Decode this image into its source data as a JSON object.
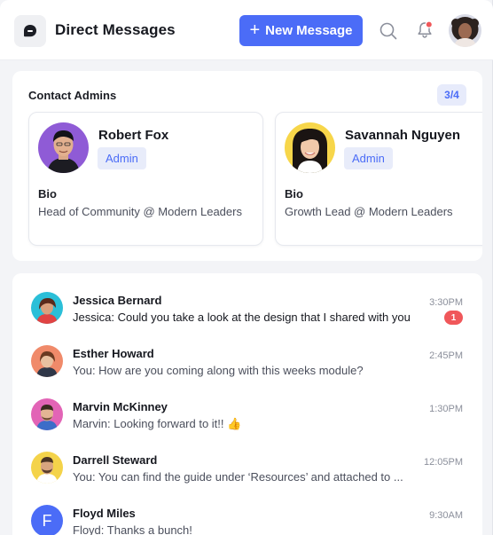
{
  "header": {
    "title": "Direct Messages",
    "new_message_label": "New Message",
    "app_icon": "chat-bubble-icon",
    "search_icon": "search-icon",
    "bell_icon": "bell-icon",
    "has_notification": true
  },
  "admins": {
    "title": "Contact Admins",
    "counter": "3/4",
    "cards": [
      {
        "name": "Robert Fox",
        "role": "Admin",
        "bio_label": "Bio",
        "bio": "Head of Community @ Modern Leaders"
      },
      {
        "name": "Savannah Nguyen",
        "role": "Admin",
        "bio_label": "Bio",
        "bio": "Growth Lead @ Modern Leaders"
      }
    ]
  },
  "messages": [
    {
      "name": "Jessica Bernard",
      "preview": "Jessica: Could you take a look at the design that I shared with you?",
      "time": "3:30PM",
      "unread": "1"
    },
    {
      "name": "Esther Howard",
      "preview": "You: How are you coming along with this weeks module?",
      "time": "2:45PM"
    },
    {
      "name": "Marvin McKinney",
      "preview": "Marvin: Looking forward to it!! 👍",
      "time": "1:30PM"
    },
    {
      "name": "Darrell Steward",
      "preview": "You: You can find the guide under ‘Resources’ and attached to ...",
      "time": "12:05PM"
    },
    {
      "name": "Floyd Miles",
      "preview": "Floyd: Thanks a bunch!",
      "time": "9:30AM",
      "initial": "F"
    }
  ],
  "colors": {
    "accent": "#4b6cf7",
    "badge_bg": "#e8ecfa",
    "unread": "#f0575a",
    "notification_dot": "#f0575a"
  }
}
